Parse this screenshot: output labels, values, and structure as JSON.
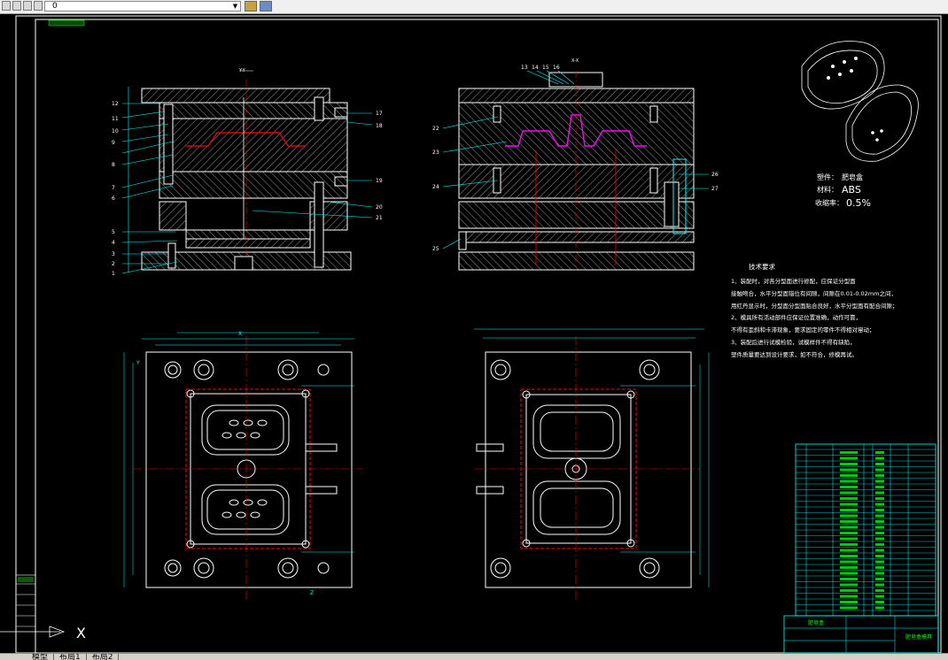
{
  "toolbar": {
    "layer_value": "0",
    "icons": [
      "new-icon",
      "open-icon",
      "save-icon",
      "print-icon"
    ]
  },
  "drawing": {
    "section_left_title": "Y-Y",
    "section_right_title": "X-X",
    "view_label_x": "X",
    "view_label_y": "Y",
    "view_label_z": "Z",
    "left_callouts": [
      "12",
      "11",
      "10",
      "9",
      "8",
      "7",
      "6",
      "5",
      "4",
      "3",
      "2",
      "1"
    ],
    "left_right_callouts": [
      "17",
      "18",
      "19",
      "20",
      "21"
    ],
    "right_top_callouts": [
      "13",
      "14",
      "15",
      "16"
    ],
    "right_left_callouts": [
      "22",
      "23",
      "24",
      "25"
    ],
    "right_right_callouts": [
      "26",
      "27"
    ],
    "part_info": {
      "name_label": "塑件：",
      "name_value": "肥皂盒",
      "material_label": "材料：",
      "material_value": "ABS",
      "shrink_label": "收缩率：",
      "shrink_value": "0.5%"
    },
    "tech_requirements": {
      "title": "技术要求",
      "lines": [
        "1、装配时，对各分型面进行修配，应保证分型面",
        "接触吻合，水平分型面错位有间隙，间隙在0.01-0.02mm之间，",
        "用红丹显示时，分型面分型面贴合良好，水平分型面有配合间隙；",
        "2、模具所有活动部件应保证位置准确，动作可靠，",
        "不得有歪斜和卡滞现象，要求固定的零件不得相对窜动；",
        "3、装配后进行试模检验，试模样件不得有缺陷，",
        "塑件质量要达到设计要求，如不符合，修模再试。"
      ]
    },
    "ucs_label": "X",
    "ucs_y": "Y"
  },
  "title_block": {
    "bottom_title": "肥皂盒",
    "drawing_name": "肥皂盒模具"
  },
  "layout_tabs": [
    "模型",
    "布局1",
    "布局2"
  ],
  "colors": {
    "background": "#000000",
    "border": "#ffffff",
    "cyan": "#00ffff",
    "red": "#ff0000",
    "green": "#00ff00",
    "yellow": "#ffff00",
    "magenta": "#ff00ff"
  }
}
